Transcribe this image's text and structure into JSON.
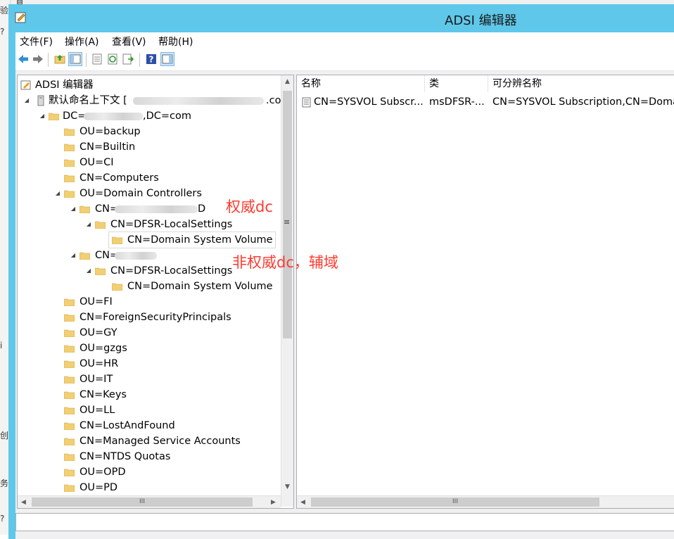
{
  "window": {
    "title": "ADSI 编辑器"
  },
  "background": {
    "left_glyphs": [
      "验",
      "?",
      "i",
      "创",
      "务",
      "?"
    ],
    "top_glyph": "直"
  },
  "menu": {
    "items": [
      "文件(F)",
      "操作(A)",
      "查看(V)",
      "帮助(H)"
    ]
  },
  "toolbar": {
    "icons": [
      "back-arrow-icon",
      "forward-arrow-icon",
      "up-folder-icon",
      "show-hide-tree-icon",
      "properties-icon",
      "refresh-icon",
      "export-list-icon",
      "help-icon",
      "show-hide-action-pane-icon"
    ]
  },
  "tree": {
    "root": "ADSI 编辑器",
    "context": "默认命名上下文 [",
    "context_suffix": ".co",
    "domain_prefix": "DC=",
    "domain_suffix": ",DC=com",
    "items": [
      "OU=backup",
      "CN=Builtin",
      "OU=CI",
      "CN=Computers",
      "OU=Domain Controllers"
    ],
    "dc1": {
      "prefix": "CN=",
      "suffix": "D",
      "child": "CN=DFSR-LocalSettings",
      "grandchild": "CN=Domain System Volume"
    },
    "dc2": {
      "prefix": "CN=",
      "child": "CN=DFSR-LocalSettings",
      "grandchild": "CN=Domain System Volume"
    },
    "items2": [
      "OU=FI",
      "CN=ForeignSecurityPrincipals",
      "OU=GY",
      "OU=gzgs",
      "OU=HR",
      "OU=IT",
      "CN=Keys",
      "OU=LL",
      "CN=LostAndFound",
      "CN=Managed Service Accounts",
      "CN=NTDS Quotas",
      "OU=OPD",
      "OU=PD"
    ]
  },
  "list": {
    "columns": [
      "名称",
      "类",
      "可分辨名称"
    ],
    "rows": [
      {
        "name": "CN=SYSVOL Subscr...",
        "class": "msDFSR-...",
        "dn": "CN=SYSVOL Subscription,CN=Doma"
      }
    ]
  },
  "annotations": {
    "authoritative": "权威dc",
    "non_authoritative": "非权威dc，辅域"
  },
  "scroll": {
    "grip": "III",
    "splitter": "≡"
  },
  "colors": {
    "titlebar": "#5fc8ea",
    "annotation": "#ff3b30",
    "folder": "#f2cf72"
  }
}
